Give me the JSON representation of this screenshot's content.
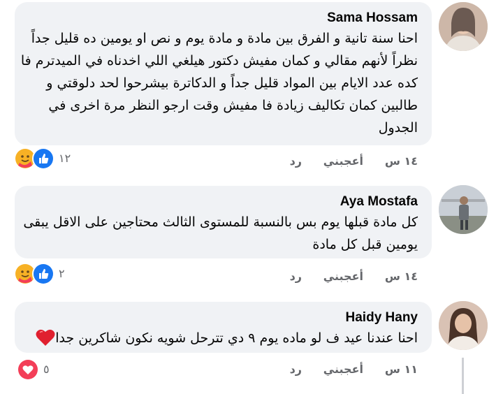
{
  "comments": [
    {
      "author": "Sama Hossam",
      "lines": [
        "احنا سنة تانية و الفرق بين مادة و مادة يوم و نص او يومين ده قليل جداً",
        "نظراً لأنهم مقالي و كمان مفيش دكتور هيلغي اللي اخدناه في الميدترم فا",
        "كده عدد الايام بين المواد قليل  جداً و الدكاترة بيشرحوا لحد دلوقتي و",
        "طالبين كمان تكاليف زيادة فا مفيش وقت ارجو النظر مرة اخرى في",
        "الجدول"
      ],
      "time": "١٤ س",
      "like_label": "أعجبني",
      "reply_label": "رد",
      "reaction_count": "١٢",
      "reactions": [
        "like-icon",
        "care-icon"
      ]
    },
    {
      "author": "Aya Mostafa",
      "lines": [
        "كل مادة قبلها يوم بس بالنسبة للمستوى الثالث محتاجين على الاقل يبقى",
        "يومين قبل كل مادة"
      ],
      "time": "١٤ س",
      "like_label": "أعجبني",
      "reply_label": "رد",
      "reaction_count": "٢",
      "reactions": [
        "like-icon",
        "care-icon"
      ]
    },
    {
      "author": "Haidy Hany",
      "lines": [
        "احنا عندنا عيد ف لو ماده يوم ٩ دي تترحل شويه نكون شاكرين جدا"
      ],
      "emoji": "red-heart-emoji",
      "time": "١١ س",
      "like_label": "أعجبني",
      "reply_label": "رد",
      "reaction_count": "٥",
      "reactions": [
        "love-icon"
      ]
    }
  ],
  "colors": {
    "bubble": "#f0f2f5",
    "meta_text": "#65676b",
    "like_blue": "#1877f2",
    "love_red": "#f33e58",
    "care_yellow": "#f7b125"
  }
}
